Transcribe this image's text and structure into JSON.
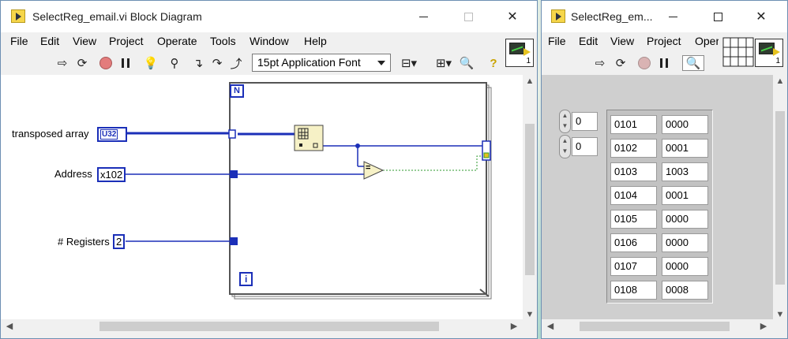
{
  "block_diagram": {
    "title": "SelectReg_email.vi Block Diagram",
    "menu": [
      "File",
      "Edit",
      "View",
      "Project",
      "Operate",
      "Tools",
      "Window",
      "Help"
    ],
    "font_select": "15pt Application Font",
    "icon_number": "1",
    "labels": {
      "transposed_array": "transposed array",
      "address": "Address",
      "registers": "# Registers"
    },
    "constants": {
      "array_type": "U32",
      "address_value": "x102",
      "registers_value": "2"
    },
    "loop": {
      "count_terminal": "N",
      "iteration_terminal": "i",
      "equal_symbol": "="
    }
  },
  "front_panel": {
    "title": "SelectReg_em...",
    "menu": [
      "File",
      "Edit",
      "View",
      "Project",
      "Oper"
    ],
    "icon_number": "1",
    "index_values": [
      "0",
      "0"
    ],
    "table": [
      [
        "0101",
        "0000"
      ],
      [
        "0102",
        "0001"
      ],
      [
        "0103",
        "1003"
      ],
      [
        "0104",
        "0001"
      ],
      [
        "0105",
        "0000"
      ],
      [
        "0106",
        "0000"
      ],
      [
        "0107",
        "0000"
      ],
      [
        "0108",
        "0008"
      ]
    ]
  }
}
